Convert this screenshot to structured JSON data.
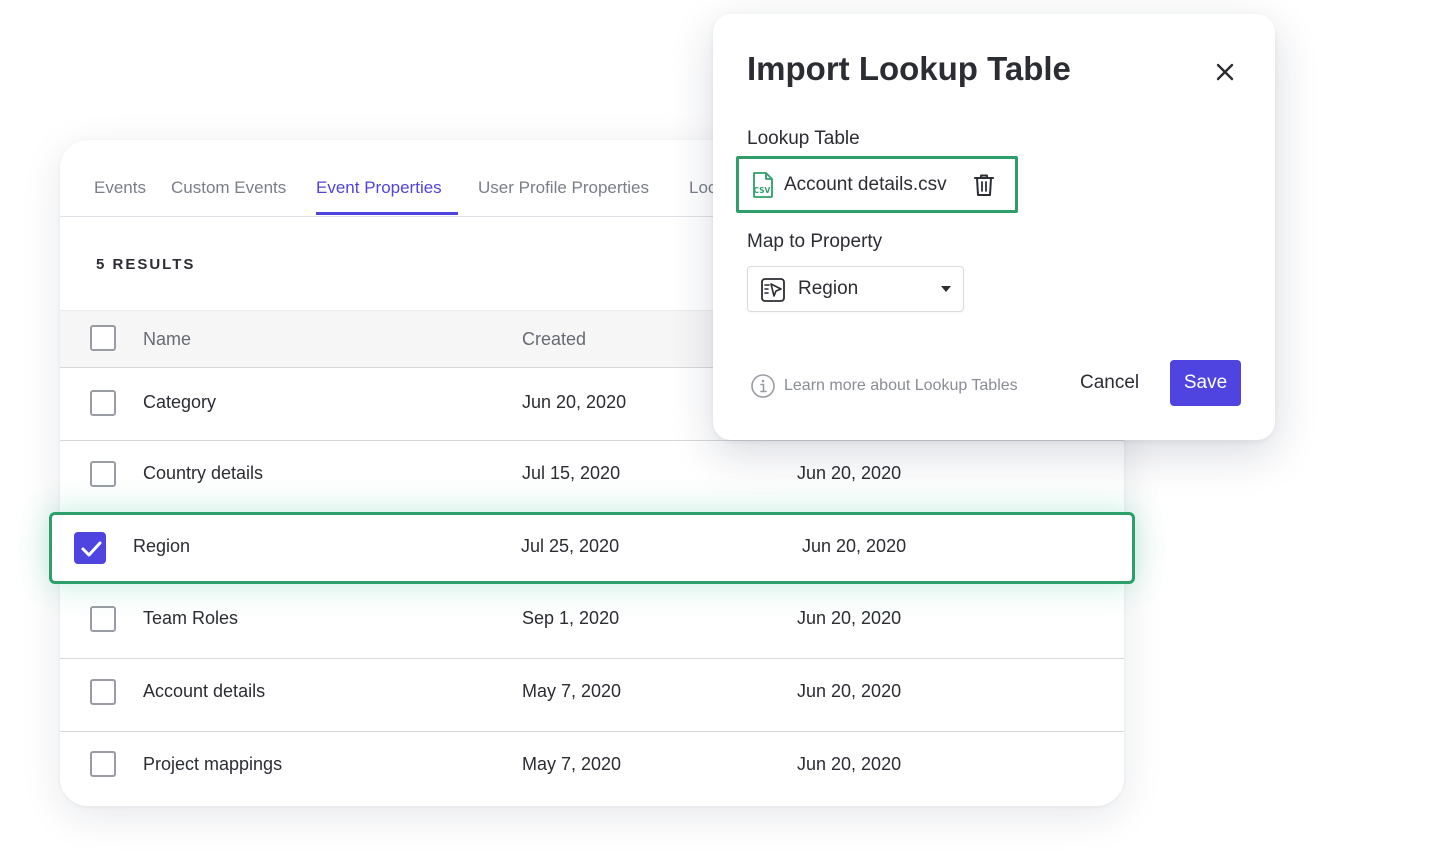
{
  "tabs": [
    {
      "label": "Events"
    },
    {
      "label": "Custom Events"
    },
    {
      "label": "Event Properties",
      "active": true
    },
    {
      "label": "User Profile Properties"
    },
    {
      "label": "Loo"
    }
  ],
  "results_label": "5 RESULTS",
  "table": {
    "columns": [
      "Name",
      "Created"
    ],
    "rows": [
      {
        "name": "Category",
        "created": "Jun 20, 2020",
        "modified": "",
        "checked": false
      },
      {
        "name": "Country details",
        "created": "Jul 15, 2020",
        "modified": "Jun 20, 2020",
        "checked": false
      },
      {
        "name": "Region",
        "created": "Jul 25, 2020",
        "modified": "Jun 20, 2020",
        "checked": true
      },
      {
        "name": "Team Roles",
        "created": "Sep 1, 2020",
        "modified": "Jun 20, 2020",
        "checked": false
      },
      {
        "name": "Account details",
        "created": "May 7, 2020",
        "modified": "Jun 20, 2020",
        "checked": false
      },
      {
        "name": "Project mappings",
        "created": "May 7, 2020",
        "modified": "Jun 20, 2020",
        "checked": false
      }
    ]
  },
  "modal": {
    "title": "Import Lookup Table",
    "lookup_label": "Lookup Table",
    "file_name": "Account details.csv",
    "map_label": "Map to Property",
    "property_value": "Region",
    "learn_more": "Learn more about Lookup Tables",
    "cancel_label": "Cancel",
    "save_label": "Save"
  },
  "icons": {
    "file": "csv-file-icon",
    "delete": "trash-icon",
    "property": "event-property-icon",
    "info": "info-icon",
    "close": "close-icon"
  },
  "colors": {
    "accent": "#4f44e0",
    "highlight": "#2e9e6b"
  }
}
